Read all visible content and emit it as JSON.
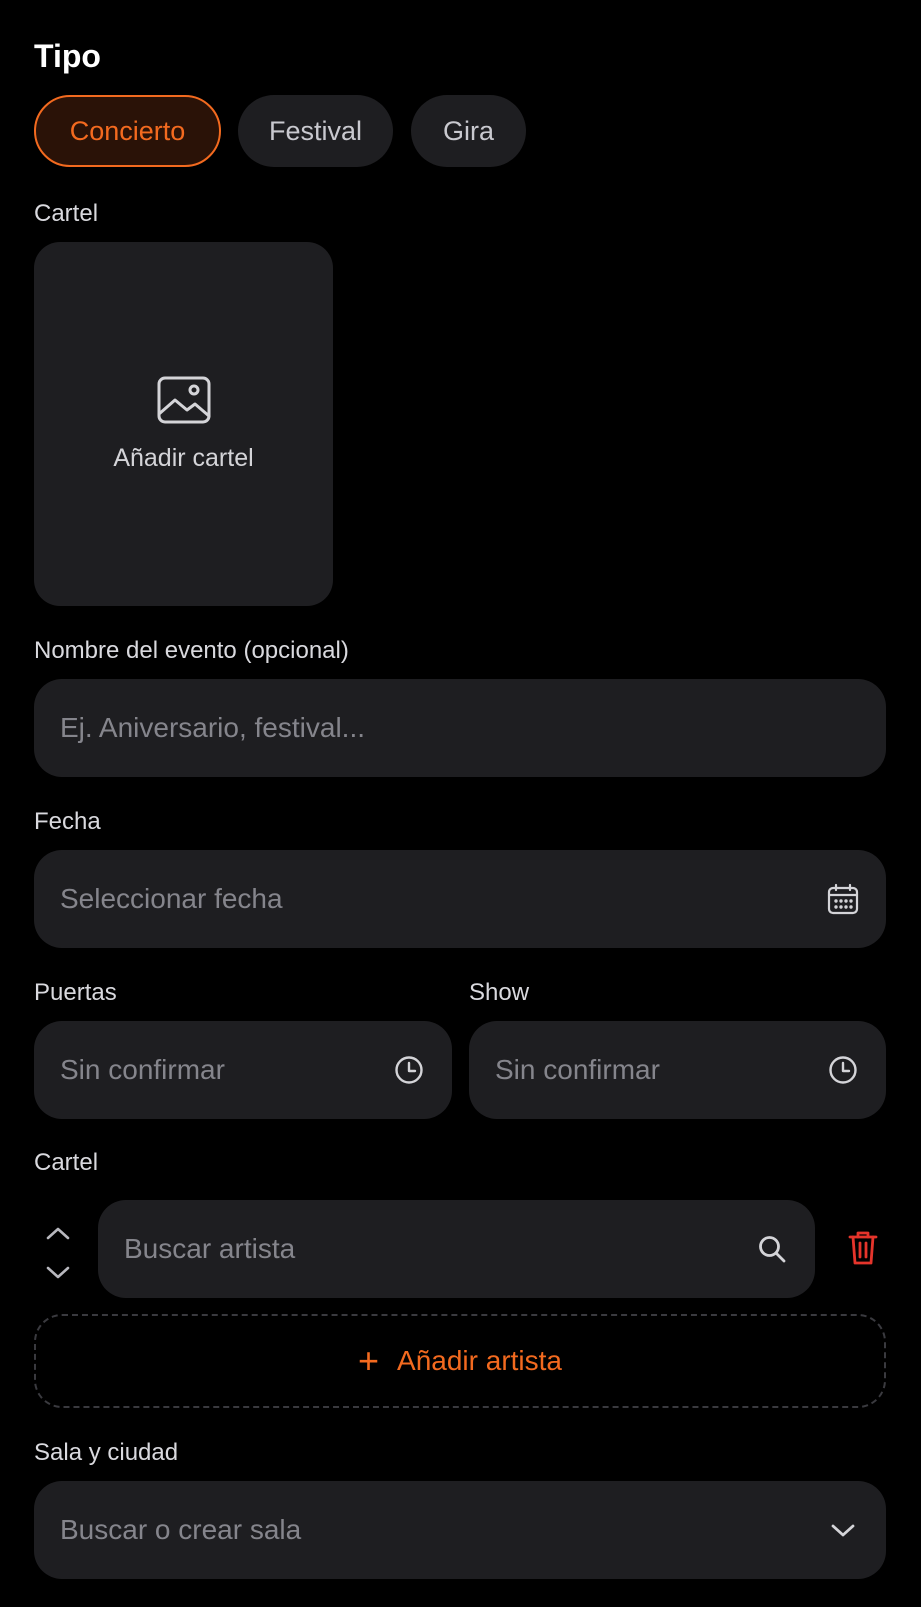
{
  "type_section": {
    "title": "Tipo",
    "options": [
      {
        "label": "Concierto",
        "selected": true
      },
      {
        "label": "Festival",
        "selected": false
      },
      {
        "label": "Gira",
        "selected": false
      }
    ]
  },
  "poster": {
    "label": "Cartel",
    "add_text": "Añadir cartel",
    "icon": "image-icon"
  },
  "event_name": {
    "label": "Nombre del evento (opcional)",
    "placeholder": "Ej. Aniversario, festival...",
    "value": ""
  },
  "date": {
    "label": "Fecha",
    "placeholder": "Seleccionar fecha",
    "icon": "calendar-icon"
  },
  "doors": {
    "label": "Puertas",
    "placeholder": "Sin confirmar",
    "icon": "clock-icon"
  },
  "show": {
    "label": "Show",
    "placeholder": "Sin confirmar",
    "icon": "clock-icon"
  },
  "lineup": {
    "label": "Cartel",
    "artist_placeholder": "Buscar artista",
    "add_label": "Añadir artista"
  },
  "venue": {
    "label": "Sala y ciudad",
    "placeholder": "Buscar o crear sala"
  },
  "colors": {
    "background": "#000000",
    "surface": "#1e1e21",
    "accent": "#f36a1f",
    "danger": "#e5342b",
    "placeholder": "#85858c"
  }
}
